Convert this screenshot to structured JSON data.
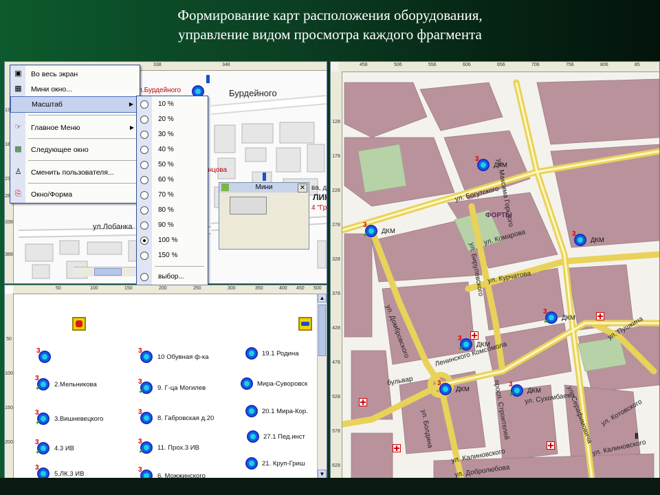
{
  "slide": {
    "title_line1": "Формирование карт расположения оборудования,",
    "title_line2": "управление видом просмотра каждого фрагмента"
  },
  "top_left_panel": {
    "ruler_top": [
      "338",
      "348"
    ],
    "ruler_left": [
      "138",
      "188",
      "238",
      "288",
      "338",
      "388"
    ],
    "map_labels": {
      "burdeynogo_red": "л.Бурдейного",
      "burdeynogo": "Бурдейного",
      "lobanka": "ул.Лобанка",
      "lyntsova": "инцова",
      "va_d": "ва, д.",
      "lints": "ЛИНЦ",
      "gr": "4 \"Гр"
    },
    "context_menu": {
      "items": [
        {
          "label": "Во весь экран",
          "icon": "fullscreen-icon"
        },
        {
          "label": "Мини окно...",
          "icon": "mini-window-icon"
        },
        {
          "label": "Масштаб",
          "icon": "",
          "submenu": true
        },
        {
          "label": "Главное Меню",
          "icon": "main-menu-icon",
          "submenu": true
        },
        {
          "label": "Следующее окно",
          "icon": "next-window-icon"
        },
        {
          "label": "Сменить пользователя...",
          "icon": "user-icon"
        },
        {
          "label": "Окно/Форма",
          "icon": "window-form-icon"
        }
      ]
    },
    "zoom_menu": {
      "options": [
        "10 %",
        "20 %",
        "30 %",
        "40 %",
        "50 %",
        "60 %",
        "70 %",
        "80 %",
        "90 %",
        "100 %",
        "150 %"
      ],
      "selected": "100 %",
      "custom": "выбор..."
    },
    "mini_window": {
      "title": "Мини"
    }
  },
  "bottom_left_panel": {
    "ruler_top": [
      "50",
      "100",
      "150",
      "200",
      "250",
      "300",
      "350",
      "400",
      "450",
      "500"
    ],
    "ruler_left": [
      "50",
      "100",
      "150",
      "200"
    ],
    "markers": [
      {
        "num": "3",
        "label": ""
      },
      {
        "num": "3",
        "label": "2.Мельникова"
      },
      {
        "num": "3",
        "label": "3.Вишневецкого"
      },
      {
        "num": "3",
        "label": "4.3 ИВ"
      },
      {
        "num": "3",
        "label": "5.ЛК.3 ИВ"
      },
      {
        "num": "3",
        "label": "10 Обувная ф-ка"
      },
      {
        "num": "3",
        "label": "9. Г-ца Могилев"
      },
      {
        "num": "3",
        "label": "8. Габровская д.20"
      },
      {
        "num": "3",
        "label": "11. Прох.3 ИВ"
      },
      {
        "num": "3",
        "label": "6. Можжинского"
      },
      {
        "num": "",
        "label": "19.1 Родина"
      },
      {
        "num": "",
        "label": "Мира-Суворовск"
      },
      {
        "num": "",
        "label": "20.1 Мира-Кор."
      },
      {
        "num": "",
        "label": "27.1 Пед.инст"
      },
      {
        "num": "",
        "label": "21. Круп-Гриш"
      }
    ]
  },
  "right_panel": {
    "ruler_top": [
      "456",
      "506",
      "556",
      "606",
      "656",
      "706",
      "756",
      "806",
      "85"
    ],
    "ruler_left": [
      "128",
      "178",
      "228",
      "278",
      "328",
      "378",
      "428",
      "478",
      "528",
      "578",
      "628"
    ],
    "streets": {
      "bogutskogo": "ул. Богутского",
      "maksima_gorkogo": "ул. Максима Горького",
      "forty": "ФОРТЫ",
      "komarova": "ул. Комарова",
      "kurchatova": "ул. Курчатова",
      "dobrovskogo": "ул. Домбровского",
      "bryalevskogo": "ул. Бирулевского",
      "leninskogo_komsomola": "Ленинского Комсомола",
      "bulvar": "бульвар",
      "pushkina": "ул. Пушкина",
      "prosp_stroiteley": "просп. Строителей",
      "sukhomlaeva": "ул. Сухомбаева",
      "boldina": "ул. Болдина",
      "kalinovskogo": "ул. Калиновского",
      "kalinovskogo2": "ул. Калиновского",
      "dobrolyubova": "ул. Добролюбова",
      "serafimovicha": "ул. Серафимовича",
      "kotovskogo": "ул. Котовского"
    },
    "markers": [
      {
        "num": "3",
        "label": "ДКМ"
      },
      {
        "num": "3",
        "label": "ДКМ"
      },
      {
        "num": "3",
        "label": "ДКМ"
      },
      {
        "num": "3",
        "label": "ДКМ"
      },
      {
        "num": "3",
        "label": "ДКМ"
      },
      {
        "num": "3",
        "label": "ДКМ"
      },
      {
        "num": "3",
        "label": "ДКМ"
      }
    ]
  }
}
